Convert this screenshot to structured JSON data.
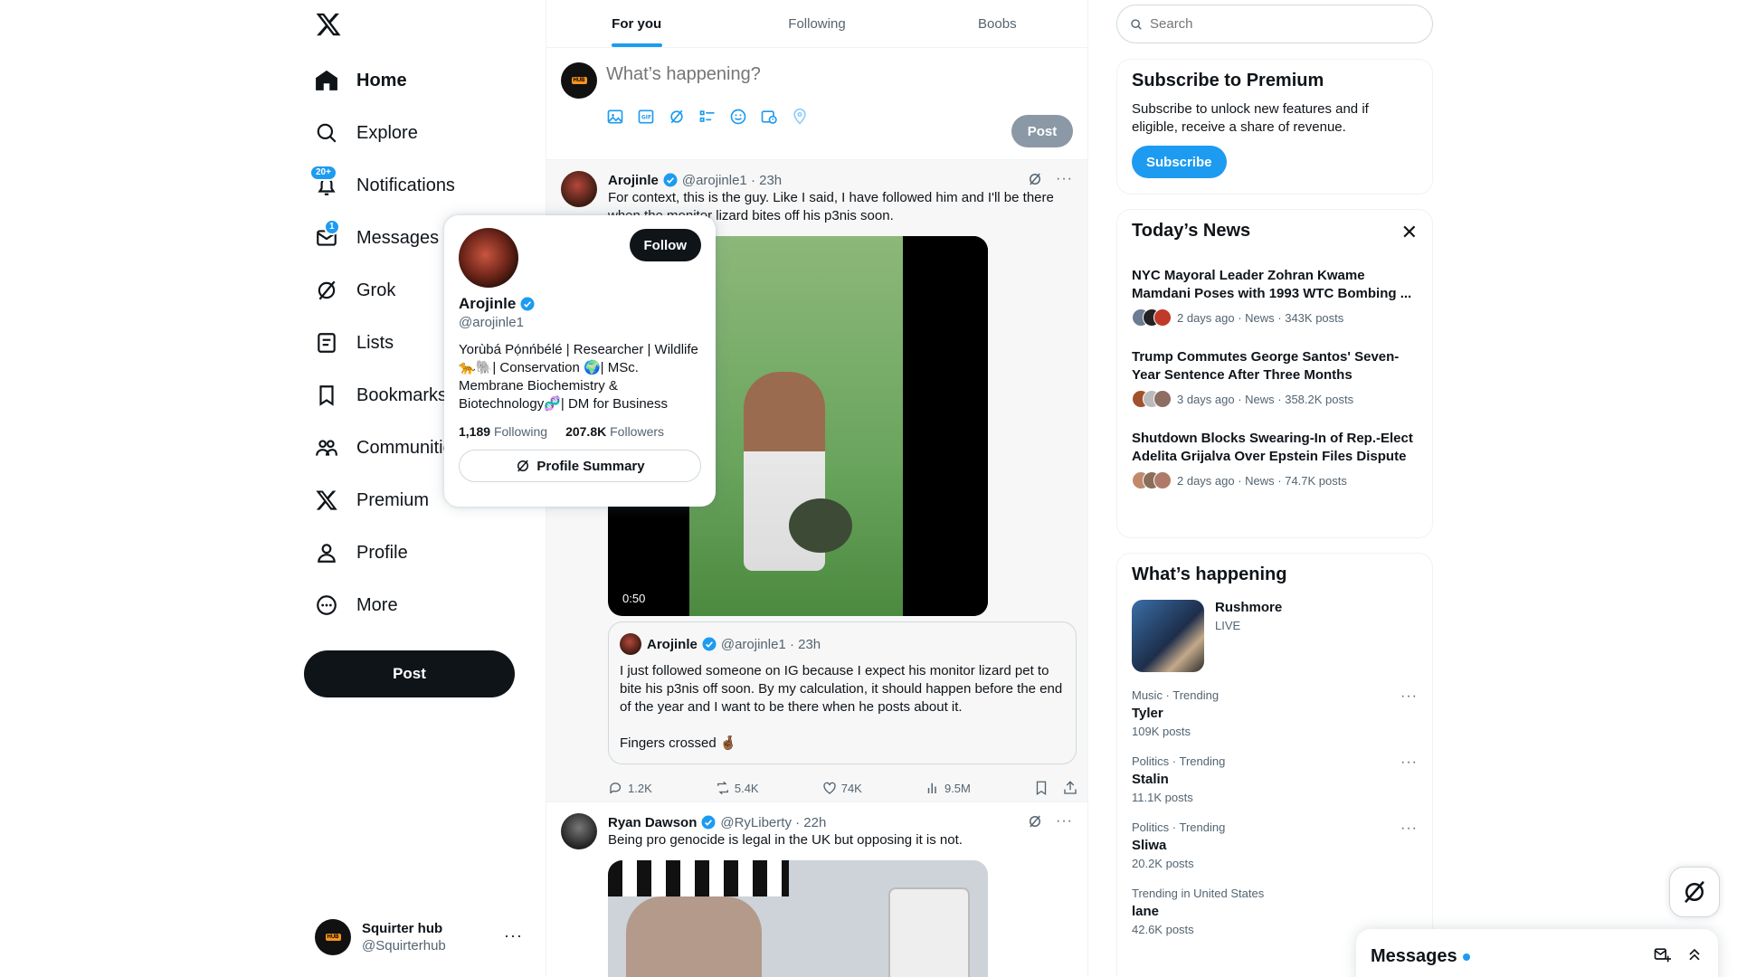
{
  "sidebar": {
    "logo_icon": "x-logo-icon",
    "items": [
      {
        "label": "Home",
        "icon": "home-icon",
        "active": true
      },
      {
        "label": "Explore",
        "icon": "search-icon"
      },
      {
        "label": "Notifications",
        "icon": "bell-icon",
        "badge": "20+"
      },
      {
        "label": "Messages",
        "icon": "envelope-icon",
        "badge": "1"
      },
      {
        "label": "Grok",
        "icon": "grok-icon"
      },
      {
        "label": "Lists",
        "icon": "list-icon"
      },
      {
        "label": "Bookmarks",
        "icon": "bookmark-icon"
      },
      {
        "label": "Communities",
        "icon": "people-icon"
      },
      {
        "label": "Premium",
        "icon": "x-logo-icon"
      },
      {
        "label": "Profile",
        "icon": "person-icon"
      },
      {
        "label": "More",
        "icon": "more-circle-icon"
      }
    ],
    "post_button": "Post",
    "account": {
      "name": "Squirter hub",
      "handle": "@Squirterhub",
      "more": "···"
    }
  },
  "main": {
    "tabs": [
      {
        "label": "For you",
        "active": true
      },
      {
        "label": "Following"
      },
      {
        "label": "Boobs"
      }
    ],
    "composer": {
      "placeholder": "What’s happening?",
      "post_button": "Post"
    },
    "tweets": [
      {
        "name": "Arojinle",
        "handle": "@arojinle1",
        "time": "· 23h",
        "text": "For context, this is the guy. Like I said, I have followed him and I'll be there when the monitor lizard bites off his p3nis soon.",
        "video_duration": "0:50",
        "quote": {
          "name": "Arojinle",
          "handle": "@arojinle1",
          "time": "· 23h",
          "text": "I just followed someone on IG because I expect his monitor lizard pet to bite his p3nis off soon. By my calculation, it should happen before the end of the year and I want to be there when he posts about it.\n\nFingers crossed 🤞🏾"
        },
        "replies": "1.2K",
        "reposts": "5.4K",
        "likes": "74K",
        "views": "9.5M"
      },
      {
        "name": "Ryan Dawson",
        "handle": "@RyLiberty",
        "time": "· 22h",
        "text": "Being pro genocide is legal in the UK but opposing it is not."
      }
    ]
  },
  "hovercard": {
    "name": "Arojinle",
    "handle": "@arojinle1",
    "follow_button": "Follow",
    "bio": "Yorùbá Pọ́nńbélé | Researcher | Wildlife 🐆🐘| Conservation 🌍| MSc. Membrane Biochemistry & Biotechnology🧬| DM for Business",
    "following_count": "1,189",
    "following_label": "Following",
    "followers_count": "207.8K",
    "followers_label": "Followers",
    "summary_button": "Profile Summary"
  },
  "right": {
    "search_placeholder": "Search",
    "premium": {
      "title": "Subscribe to Premium",
      "text": "Subscribe to unlock new features and if eligible, receive a share of revenue.",
      "button": "Subscribe"
    },
    "news": {
      "title": "Today’s News",
      "items": [
        {
          "title": "NYC Mayoral Leader Zohran Kwame Mamdani Poses with 1993 WTC Bombing ...",
          "meta": "2 days ago · News · 343K posts"
        },
        {
          "title": "Trump Commutes George Santos' Seven-Year Sentence After Three Months",
          "meta": "3 days ago · News · 358.2K posts"
        },
        {
          "title": "Shutdown Blocks Swearing-In of Rep.-Elect Adelita Grijalva Over Epstein Files Dispute",
          "meta": "2 days ago · News · 74.7K posts"
        }
      ]
    },
    "happening": {
      "title": "What’s happening",
      "live": {
        "title": "Rushmore",
        "status": "LIVE"
      },
      "trends": [
        {
          "category": "Music · Trending",
          "name": "Tyler",
          "count": "109K posts"
        },
        {
          "category": "Politics · Trending",
          "name": "Stalin",
          "count": "11.1K posts"
        },
        {
          "category": "Politics · Trending",
          "name": "Sliwa",
          "count": "20.2K posts"
        },
        {
          "category": "Trending in United States",
          "name": "lane",
          "count": "42.6K posts"
        }
      ]
    }
  },
  "messages_drawer": {
    "title": "Messages"
  },
  "colors": {
    "accent": "#1d9bf0",
    "text": "#0f1419",
    "muted": "#536471",
    "border": "#eff3f4"
  }
}
